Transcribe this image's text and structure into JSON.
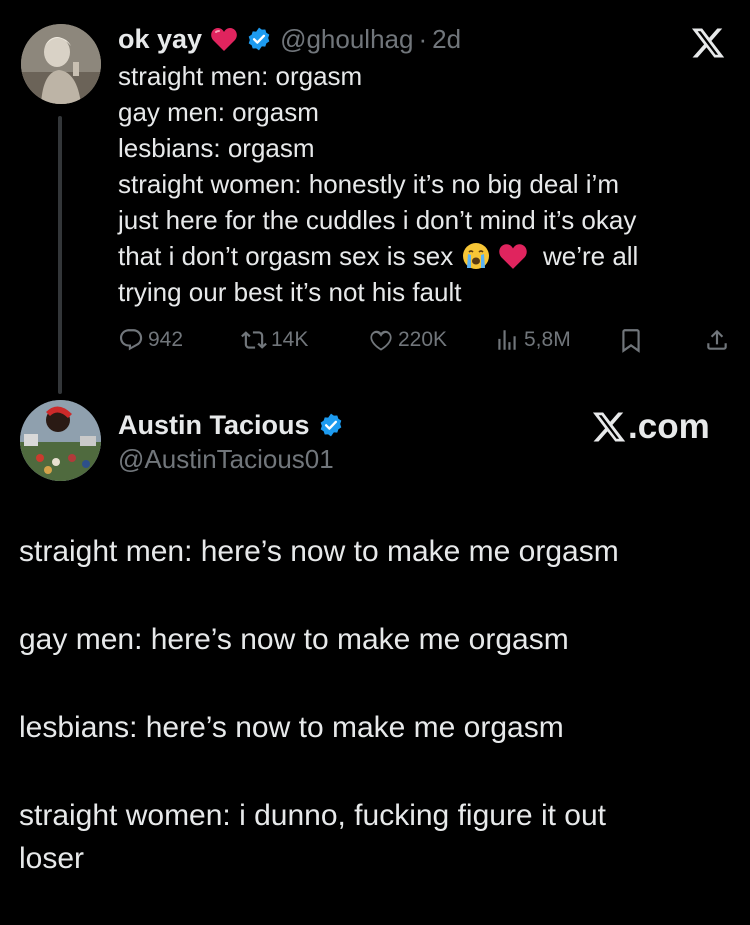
{
  "tweet1": {
    "display_name": "ok yay",
    "handle": "@ghoulhag",
    "separator": "·",
    "time": "2d",
    "lines": [
      "straight men: orgasm",
      "gay men: orgasm",
      "lesbians: orgasm",
      "straight women: honestly it’s no big deal i’m",
      "just here for the cuddles i don’t mind it’s okay",
      "that i don’t orgasm sex is sex",
      "we’re all",
      "trying our best it’s not his fault"
    ],
    "actions": {
      "replies": "942",
      "reposts": "14K",
      "likes": "220K",
      "views": "5,8M"
    }
  },
  "tweet2": {
    "display_name": "Austin Tacious",
    "handle": "@AustinTacious01",
    "watermark": ".com",
    "paragraphs": [
      "straight men: here’s now to make me orgasm",
      "gay men: here’s now to make me orgasm",
      "lesbians: here’s now to make me orgasm",
      "straight women: i dunno, fucking figure it out loser"
    ]
  },
  "colors": {
    "background": "#000000",
    "text": "#e7e9ea",
    "muted": "#71767b",
    "verified": "#1d9bf0",
    "heart": "#e0245e"
  },
  "icons": [
    "heart-emoji",
    "verified-badge",
    "x-logo",
    "reply-icon",
    "repost-icon",
    "like-icon",
    "views-icon",
    "bookmark-icon",
    "share-icon",
    "crying-emoji"
  ]
}
